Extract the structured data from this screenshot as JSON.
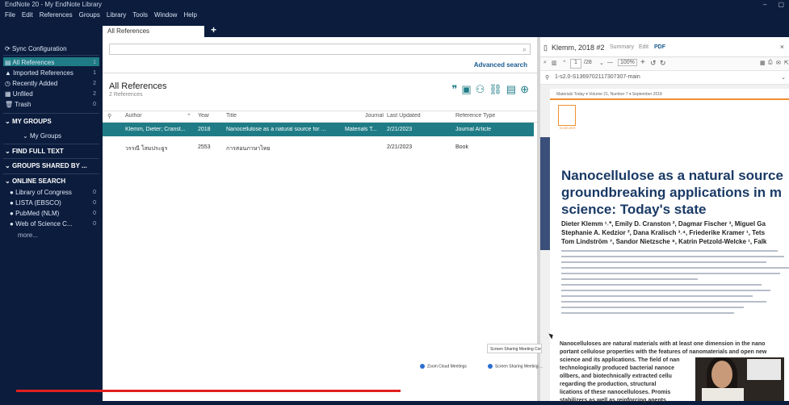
{
  "window": {
    "title": "EndNote 20 - My EndNote Library"
  },
  "menu": [
    "File",
    "Edit",
    "References",
    "Groups",
    "Library",
    "Tools",
    "Window",
    "Help"
  ],
  "tabs": [
    {
      "label": "All References"
    }
  ],
  "sidebar": {
    "sync": "Sync Configuration",
    "items": [
      {
        "label": "All References",
        "count": "1"
      },
      {
        "label": "Imported References",
        "count": "1"
      },
      {
        "label": "Recently Added",
        "count": "2"
      },
      {
        "label": "Unfiled",
        "count": "2"
      },
      {
        "label": "Trash",
        "count": "0"
      }
    ],
    "my_groups": "MY GROUPS",
    "my_groups_item": "My Groups",
    "find_full_text": "FIND FULL TEXT",
    "groups_shared": "GROUPS SHARED BY ...",
    "online_search": "ONLINE SEARCH",
    "online_items": [
      {
        "label": "Library of Congress",
        "count": "0"
      },
      {
        "label": "LISTA (EBSCO)",
        "count": "0"
      },
      {
        "label": "PubMed (NLM)",
        "count": "0"
      },
      {
        "label": "Web of Science C...",
        "count": "0"
      }
    ],
    "more": "more..."
  },
  "main": {
    "advanced_search": "Advanced search",
    "title": "All References",
    "subtitle": "2 References",
    "columns": [
      "Author",
      "Year",
      "Title",
      "Journal",
      "Last Updated",
      "Reference Type"
    ],
    "rows": [
      {
        "author": "Klemm, Dieter; Cranst...",
        "year": "2018",
        "title": "Nanocellulose as a natural source for ...",
        "journal": "Materials T...",
        "updated": "2/21/2023",
        "type": "Journal Article"
      },
      {
        "author": "วรรณี โสมประยูร",
        "year": "2553",
        "title": "การสอนภาษาไทย",
        "journal": "",
        "updated": "2/21/2023",
        "type": "Book"
      }
    ]
  },
  "pdf": {
    "ref": "Klemm, 2018 #2",
    "tabs": [
      "Summary",
      "Edit",
      "PDF"
    ],
    "page": "1",
    "pages": "/28",
    "zoom": "100%",
    "filename": "1-s2.0-S1369702117307307-main",
    "journal_line": "Materials Today ▾ Volume 21, Number 7 ▾ September 2018",
    "publisher": "ELSEVIER",
    "title_lines": [
      "Nanocellulose as a natural source",
      "groundbreaking applications in m",
      "science: Today's state"
    ],
    "author_lines": [
      "Dieter Klemm ¹˒*, Emily D. Cranston ², Dagmar Fischer ³, Miguel Ga",
      "Stephanie A. Kedzior ², Dana Kralisch ³˒⁴, Friederike Kramer ¹, Tets",
      "Tom Lindström ⁷, Sandor Nietzsche ⁸, Katrin Petzold-Welcke ¹, Falk"
    ],
    "abstract_lines": [
      "Nanocelluloses are natural materials with at least one dimension in the nano",
      "portant cellulose properties with the features of nanomaterials and open new",
      "science and its applications. The field of nan",
      "technologically produced bacterial nanoce",
      "ollbers, and biotechnically extracted cellu",
      "regarding the production, structural",
      "lications of these nanocelluloses. Promis",
      "stabilizers as well as reinforcing agents"
    ]
  },
  "overlay": {
    "popup": "Screen Sharing Meeting Controls",
    "taskbar": [
      "Zoom Cloud Meetings",
      "Screen Sharing Meeting ..."
    ]
  },
  "colors": {
    "accent": "#1f7c86",
    "sidebar": "#0b1c3d",
    "progress": "#e0201e"
  }
}
